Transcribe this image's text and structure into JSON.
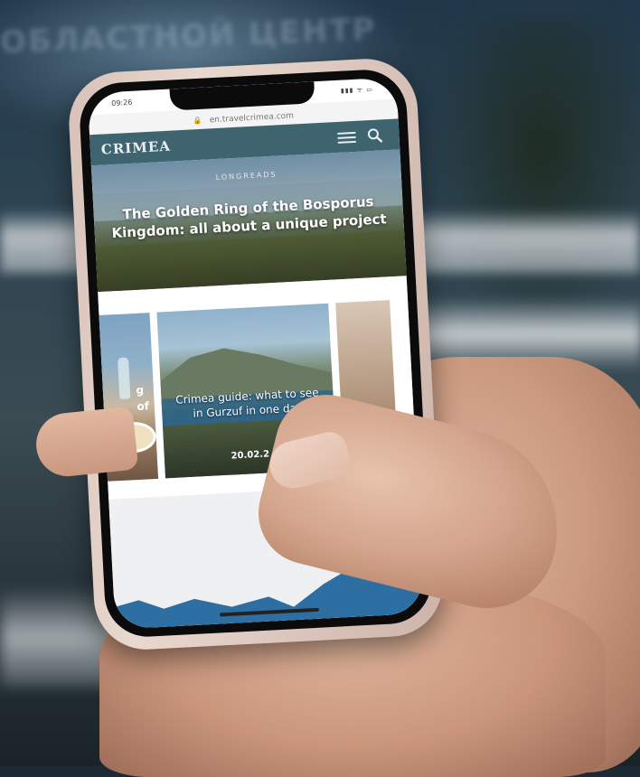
{
  "screen": {
    "status": {
      "time": "09:26",
      "indicators": "▮▮▮ ᯤ ▭"
    },
    "url": "en.travelcrimea.com",
    "header": {
      "logo": "CRIMEA"
    },
    "hero": {
      "kicker": "LONGREADS",
      "title": "The Golden Ring of the Bosporus Kingdom: all about a unique project"
    },
    "carousel": {
      "left_card_text": "g\nof",
      "main_card": {
        "title": "Crimea guide: what to see in Gurzuf in one day",
        "date": "20.02.2"
      }
    }
  },
  "background": {
    "sign_text": "ОБЛАСТНОЙ ЦЕНТР"
  },
  "colors": {
    "header": "#3e6470",
    "map_sea": "#2d6ea3",
    "phone_case": "#d7c1b8"
  }
}
